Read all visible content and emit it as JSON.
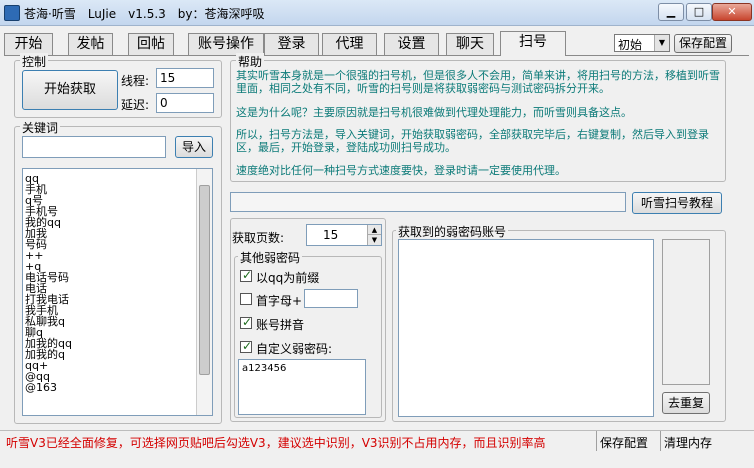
{
  "window": {
    "title": "苍海·听雪　LuJie　v1.5.3　by：苍海深呼吸",
    "min_icon": "minimize-icon",
    "max_icon": "maximize-icon",
    "close_icon": "close-icon"
  },
  "tabs": [
    "开始",
    "发帖",
    "回帖",
    "账号操作",
    "登录",
    "代理",
    "设置",
    "聊天",
    "扫号"
  ],
  "active_tab": "扫号",
  "profile": {
    "selected": "初始",
    "save_label": "保存配置"
  },
  "control": {
    "title": "控制",
    "start_label": "开始获取",
    "threads_label": "线程:",
    "threads_value": "15",
    "delay_label": "延迟:",
    "delay_value": "0"
  },
  "keywords": {
    "title": "关键词",
    "input_value": "",
    "import_label": "导入",
    "items": [
      "qq",
      "手机",
      "q号",
      "手机号",
      "我的qq",
      "加我",
      "号码",
      "++",
      "+q",
      "电话号码",
      "电话",
      "打我电话",
      "我手机",
      "私聊我q",
      "聊q",
      "加我的qq",
      "加我的q",
      "qq+",
      "@qq",
      "@163"
    ]
  },
  "help": {
    "title": "帮助",
    "p1": "其实听雪本身就是一个很强的扫号机，但是很多人不会用，简单来讲，将用扫号的方法，移植到听雪里面，相同之处有不同，听雪的扫号则是将获取弱密码与测试密码拆分开来。",
    "p2": "这是为什么呢？主要原因就是扫号机很难做到代理处理能力，而听雪则具备这点。",
    "p3": "所以，扫号方法是，导入关键词，开始获取弱密码，全部获取完毕后，右键复制，然后导入到登录区，最后，开始登录，登陆成功则扫号成功。",
    "p4": "速度绝对比任何一种扫号方式速度要快，登录时请一定要使用代理。"
  },
  "tutorial": {
    "input_value": "",
    "button_label": "听雪扫号教程"
  },
  "pages": {
    "label": "获取页数:",
    "value": "15"
  },
  "weak": {
    "title": "其他弱密码",
    "opt1": "以qq为前缀",
    "opt1_checked": true,
    "opt2": "首字母+",
    "opt2_checked": false,
    "opt2_value": "",
    "opt3": "账号拼音",
    "opt3_checked": true,
    "opt4": "自定义弱密码:",
    "opt4_checked": true,
    "custom_value": "a123456"
  },
  "result": {
    "title": "获取到的弱密码账号",
    "dedupe_label": "去重复"
  },
  "status": {
    "message": "听雪V3已经全面修复，可选择网页贴吧后勾选V3，建议选中识别，V3识别不占用内存，而且识别率高",
    "save_label": "保存配置",
    "clear_label": "清理内存"
  }
}
